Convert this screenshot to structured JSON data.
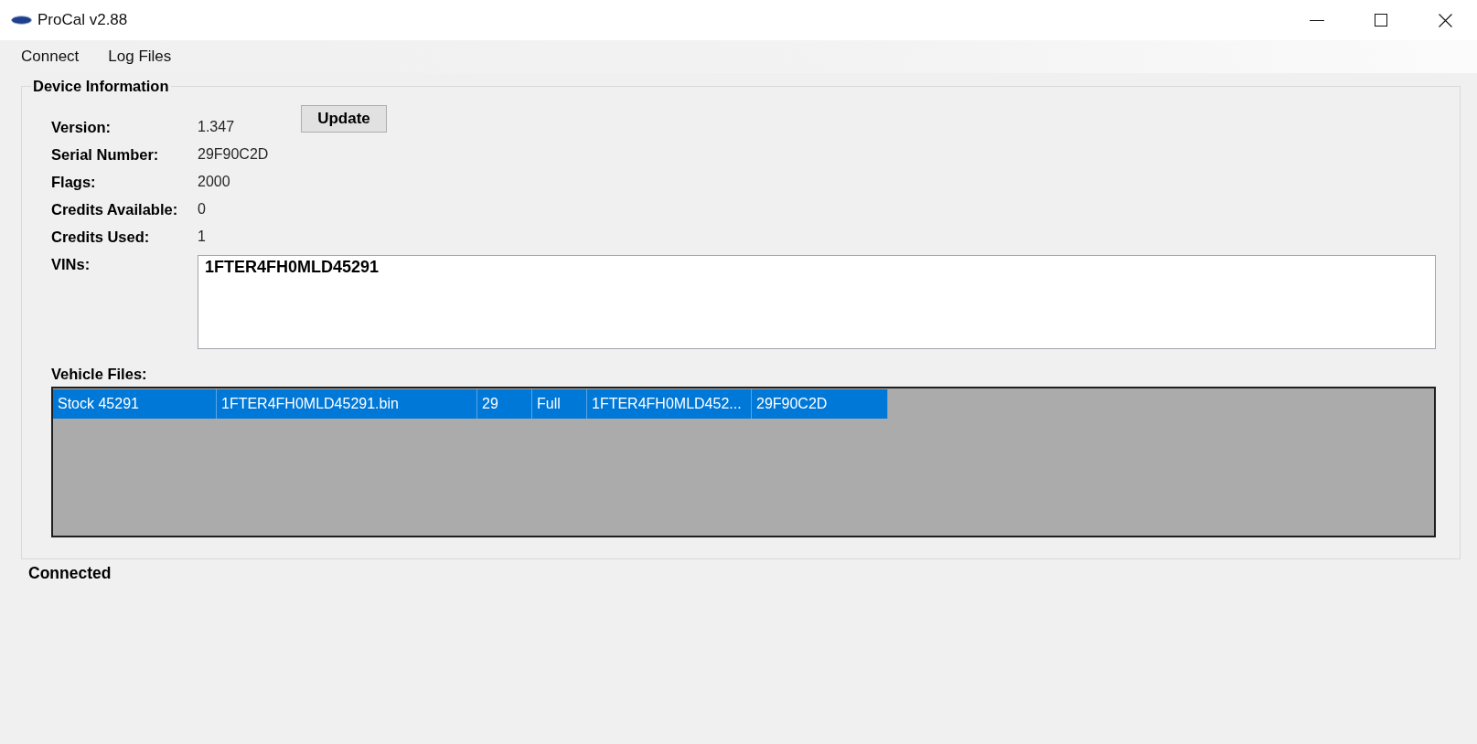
{
  "window": {
    "title": "ProCal v2.88"
  },
  "menu": [
    "Connect",
    "Log Files"
  ],
  "device_information": {
    "title": "Device Information",
    "update_button": "Update",
    "fields": [
      {
        "label": "Version:",
        "value": "1.347"
      },
      {
        "label": "Serial Number:",
        "value": "29F90C2D"
      },
      {
        "label": "Flags:",
        "value": "2000"
      },
      {
        "label": "Credits Available:",
        "value": "0"
      },
      {
        "label": "Credits Used:",
        "value": "1"
      }
    ],
    "vins": {
      "label": "VINs:",
      "value": "1FTER4FH0MLD45291"
    },
    "vehicle_files": {
      "label": "Vehicle Files:",
      "rows": [
        {
          "selected": true,
          "cells": [
            "Stock 45291",
            "1FTER4FH0MLD45291.bin",
            "29",
            "Full",
            "1FTER4FH0MLD452...",
            "29F90C2D"
          ]
        }
      ]
    }
  },
  "status_bar": {
    "text": "Connected"
  }
}
